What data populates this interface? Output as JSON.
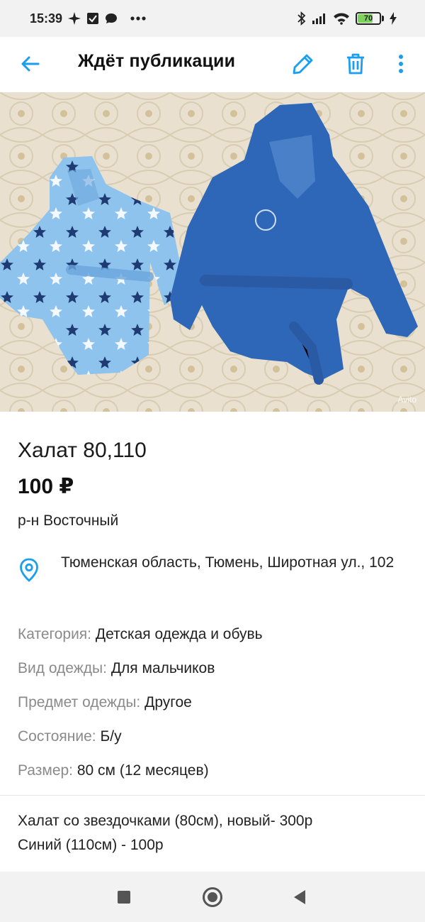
{
  "status_bar": {
    "time": "15:39",
    "battery_level": "70",
    "notification_icons": [
      "sparkle-icon",
      "check-box-icon",
      "chat-bubble-icon",
      "more-dots-icon"
    ],
    "system_icons": [
      "bluetooth-icon",
      "signal-icon",
      "wifi-icon",
      "battery-icon",
      "charging-icon"
    ]
  },
  "app_bar": {
    "title": "Ждёт публикации",
    "accent_color": "#1a9ef0",
    "actions": [
      "edit-icon",
      "trash-icon",
      "more-vert-icon"
    ]
  },
  "photo": {
    "watermark": "Avito",
    "alt": "Халат 80,110"
  },
  "item": {
    "title": "Халат 80,110",
    "price": "100 ₽",
    "district": "р-н Восточный",
    "address": "Тюменская область, Тюмень, Широтная ул., 102"
  },
  "params": [
    {
      "label": "Категория:",
      "value": "Детская одежда и обувь"
    },
    {
      "label": "Вид одежды:",
      "value": "Для мальчиков"
    },
    {
      "label": "Предмет одежды:",
      "value": "Другое"
    },
    {
      "label": "Состояние:",
      "value": "Б/у"
    },
    {
      "label": "Размер:",
      "value": "80 см (12 месяцев)"
    }
  ],
  "description": "Халат со звездочками (80см), новый- 300р\nСиний (110см) - 100р",
  "nav_bar": {
    "buttons": [
      "recents-square-icon",
      "home-circle-icon",
      "back-triangle-icon"
    ]
  }
}
